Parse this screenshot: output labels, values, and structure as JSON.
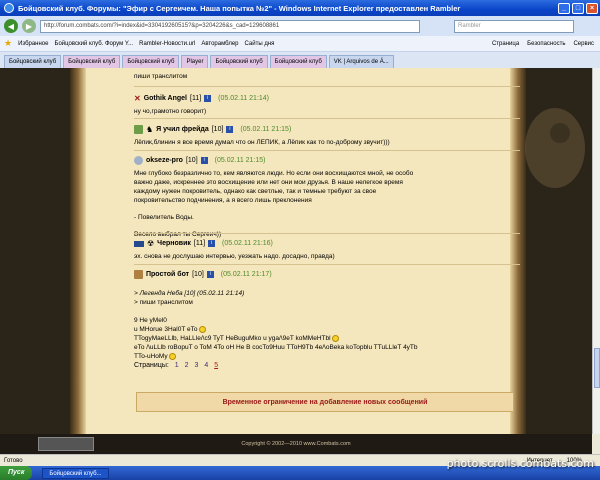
{
  "window": {
    "title": "Бойцовский клуб. Форумы: \"Эфир с Сергеичем. Наша попытка №2\" - Windows Internet Explorer предоставлен Rambler"
  },
  "address": {
    "url": "http://forum.combats.com/?i=index&id=330419260515?&p=3204226&s_cad=129608861",
    "search_placeholder": "Rambler"
  },
  "favbar": {
    "favorites": "Избранное",
    "item1": "Бойцовский клуб. Форум Y...",
    "item2": "Rambler-Новости.url",
    "item3": "Авторамблер",
    "item4": "Сайты дня",
    "right_items": [
      "Страница",
      "Безопасность",
      "Сервис"
    ]
  },
  "tabs": [
    {
      "label": "Бойцовский клуб"
    },
    {
      "label": "Бойцовский клуб"
    },
    {
      "label": "Бойцовский клуб"
    },
    {
      "label": "Player"
    },
    {
      "label": "Бойцовский клуб"
    },
    {
      "label": "Бойцовский клуб"
    },
    {
      "label": "VK | Arquivos de Á..."
    }
  ],
  "posts": [
    {
      "body": "пиши транслитом"
    },
    {
      "nick": "Gothik Angel",
      "level": "[11]",
      "date": "(05.02.11 21:14)",
      "body": "ну чо,грамотно говорит)"
    },
    {
      "nick": "Я учил фрейда",
      "level": "[10]",
      "date": "(05.02.11 21:15)",
      "body": "Лёпик,блинин я все время думал что он ЛЕПИК, а Лёпик как то по-доброму звучит)))"
    },
    {
      "nick": "okseze-pro",
      "level": "[10]",
      "date": "(05.02.11 21:15)",
      "body_lines": [
        "Мне глубоко безразлично то, кем являются люди. Но если они восхищаются мной, не особо",
        "важно даже, искреннее это восхищение или нет они мои друзья. В наше нелегкое время",
        "каждому нужен покровитель, однако как светлые, так и темные требуют за свое",
        "покровительство подчинения, а я всего лишь преклонения",
        "",
        "- Повелитель Воды.",
        "",
        "Весело выбрал ты Сергеич))"
      ]
    },
    {
      "nick": "Черновик",
      "level": "[11]",
      "date": "(05.02.11 21:16)",
      "body": "эх. снова не дослушаю интервью, уезжать надо. досадно, правда)"
    },
    {
      "nick": "Простой бот",
      "level": "[10]",
      "date": "(05.02.11 21:17)",
      "quote_line1": "> Легенда Неба [10] (05.02.11 21:14)",
      "quote_line2": "> пиши транслитом",
      "body_lines": [
        "9 He yMel0",
        "u MHorue 3Hal0T eTo",
        "TTogyMaeLLlb, HaLLle/\\c9 TyT HeBuguMko u yga/\\9eT koMMeHTbl",
        "eTo /\\uLLlb roBopuT o ToM 4To oH He B cocTo9Huu TToH9Tb 4e/\\oBeka koTopblu TTuLLleT 4yTb",
        "TTo-uHoMy"
      ]
    }
  ],
  "pagination": {
    "label": "Страницы:",
    "pages": [
      "1",
      "2",
      "3",
      "4",
      "5"
    ]
  },
  "warning": "Временное ограничение на добавление новых сообщений",
  "footer": "Copyright © 2002—2010 www.Combats.com",
  "status": {
    "left": "Готово",
    "zone": "Интернет",
    "zoom": "100%"
  },
  "taskbar": {
    "start": "Пуск",
    "task": "Бойцовский клуб..."
  },
  "watermark": "photo.scrolls.combats.com"
}
